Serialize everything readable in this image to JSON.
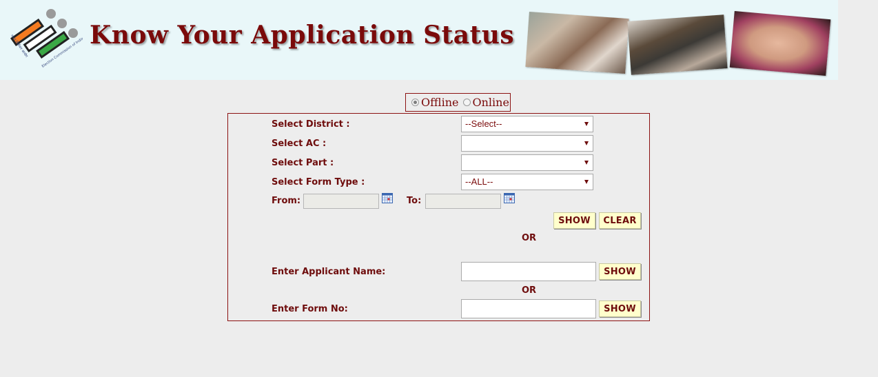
{
  "banner": {
    "title": "Know Your Application Status",
    "logo_caption_en": "Election Commission of India",
    "logo_caption_hi": "भारत निर्वाचन आयोग",
    "logo_stripe_colors": [
      "#f47b20",
      "#ffffff",
      "#3aa845"
    ],
    "photos": [
      "voters-showing-id-cards",
      "voting-machine",
      "woman-showing-inked-finger"
    ]
  },
  "mode": {
    "options": [
      {
        "label": "Offline",
        "checked": true
      },
      {
        "label": "Online",
        "checked": false
      }
    ]
  },
  "filters": {
    "district": {
      "label": "Select District :",
      "value": "--Select--"
    },
    "ac": {
      "label": "Select AC :",
      "value": ""
    },
    "part": {
      "label": "Select Part :",
      "value": ""
    },
    "form_type": {
      "label": "Select Form Type :",
      "value": "--ALL--"
    },
    "from": {
      "label": "From:",
      "value": ""
    },
    "to": {
      "label": "To:",
      "value": ""
    },
    "show_label": "SHOW",
    "clear_label": "CLEAR"
  },
  "or_label": "OR",
  "applicant_search": {
    "label": "Enter Applicant Name:",
    "value": "",
    "show_label": "SHOW"
  },
  "form_search": {
    "label": "Enter Form No:",
    "value": "",
    "show_label": "SHOW"
  },
  "colors": {
    "accent": "#7a0a0a",
    "button_bg": "#ffffcc",
    "page_bg": "#ededed",
    "banner_bg": "#e9f7f9"
  }
}
